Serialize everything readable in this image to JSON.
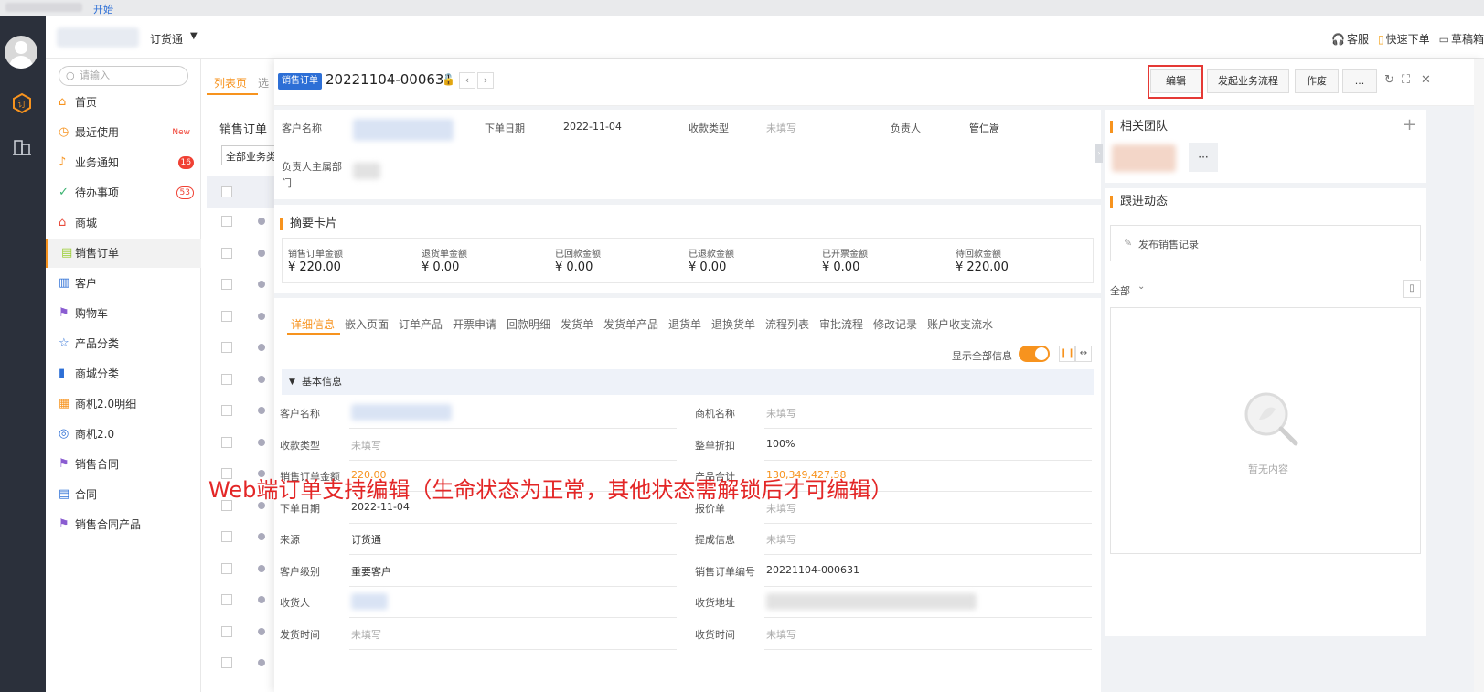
{
  "topstrip": {
    "start": "开始"
  },
  "header": {
    "app_name": "订货通",
    "right": [
      {
        "icon": "headset-icon",
        "glyph": "🎧",
        "label": "客服"
      },
      {
        "icon": "quick-order-icon",
        "glyph": "▯",
        "label": "快速下单"
      },
      {
        "icon": "draft-icon",
        "glyph": "▭",
        "label": "草稿箱"
      }
    ]
  },
  "sidenav": {
    "search_placeholder": "请输入",
    "items": [
      {
        "label": "首页",
        "icon": "home-icon",
        "glyph": "⌂",
        "color": "#f7931e"
      },
      {
        "label": "最近使用",
        "icon": "clock-icon",
        "glyph": "◷",
        "color": "#f7931e",
        "tag": "New"
      },
      {
        "label": "业务通知",
        "icon": "bell-icon",
        "glyph": "♪",
        "color": "#f7931e",
        "badge": "16"
      },
      {
        "label": "待办事项",
        "icon": "check-circle-icon",
        "glyph": "✓",
        "color": "#3cb371",
        "badge_outline": "53"
      },
      {
        "label": "商城",
        "icon": "shop-icon",
        "glyph": "⌂",
        "color": "#e84c3d"
      },
      {
        "label": "销售订单",
        "icon": "order-icon",
        "glyph": "▤",
        "color": "#9acd32",
        "active": true
      },
      {
        "label": "客户",
        "icon": "customer-icon",
        "glyph": "▥",
        "color": "#2d6fd6"
      },
      {
        "label": "购物车",
        "icon": "flag-icon",
        "glyph": "⚑",
        "color": "#8a5cd1"
      },
      {
        "label": "产品分类",
        "icon": "product-category-icon",
        "glyph": "☆",
        "color": "#2d6fd6"
      },
      {
        "label": "商城分类",
        "icon": "bar-chart-icon",
        "glyph": "▮",
        "color": "#2d6fd6"
      },
      {
        "label": "商机2.0明细",
        "icon": "opportunity-detail-icon",
        "glyph": "▦",
        "color": "#f7931e"
      },
      {
        "label": "商机2.0",
        "icon": "target-icon",
        "glyph": "◎",
        "color": "#2d6fd6"
      },
      {
        "label": "销售合同",
        "icon": "flag-icon",
        "glyph": "⚑",
        "color": "#8a5cd1"
      },
      {
        "label": "合同",
        "icon": "contract-icon",
        "glyph": "▤",
        "color": "#2d6fd6"
      },
      {
        "label": "销售合同产品",
        "icon": "flag-icon",
        "glyph": "⚑",
        "color": "#8a5cd1"
      }
    ]
  },
  "listpane": {
    "tab_active": "列表页",
    "tab_other": "选",
    "title": "销售订单",
    "filter": "全部业务类型"
  },
  "drawer": {
    "tag": "销售订单",
    "order_no": "20221104-000631",
    "buttons": {
      "edit": "编辑",
      "start_flow": "发起业务流程",
      "void": "作废",
      "more": "..."
    },
    "info": {
      "customer_name_label": "客户名称",
      "order_date_label": "下单日期",
      "order_date": "2022-11-04",
      "collection_type_label": "收款类型",
      "collection_type": "未填写",
      "owner_label": "负责人",
      "owner": "管仁嵩",
      "owner_dept_label_1": "负责人主属部",
      "owner_dept_label_2": "门"
    },
    "summary": {
      "title": "摘要卡片",
      "items": [
        {
          "label": "销售订单金额",
          "value": "¥ 220.00"
        },
        {
          "label": "退货单金额",
          "value": "¥ 0.00"
        },
        {
          "label": "已回款金额",
          "value": "¥ 0.00"
        },
        {
          "label": "已退款金额",
          "value": "¥ 0.00"
        },
        {
          "label": "已开票金额",
          "value": "¥ 0.00"
        },
        {
          "label": "待回款金额",
          "value": "¥ 220.00"
        }
      ]
    },
    "tabs": [
      "详细信息",
      "嵌入页面",
      "订单产品",
      "开票申请",
      "回款明细",
      "发货单",
      "发货单产品",
      "退货单",
      "退换货单",
      "流程列表",
      "审批流程",
      "修改记录",
      "账户收支流水"
    ],
    "show_all_label": "显示全部信息",
    "basic_info": "基本信息",
    "fields_left": [
      {
        "label": "客户名称",
        "value": "",
        "blur": true
      },
      {
        "label": "收款类型",
        "value": "未填写",
        "muted": true
      },
      {
        "label": "销售订单金额",
        "value": "220.00",
        "orange": true
      },
      {
        "label": "下单日期",
        "value": "2022-11-04"
      },
      {
        "label": "来源",
        "value": "订货通"
      },
      {
        "label": "客户级别",
        "value": "重要客户"
      },
      {
        "label": "收货人",
        "value": "",
        "blur": true
      },
      {
        "label": "发货时间",
        "value": "未填写",
        "muted": true
      }
    ],
    "fields_right": [
      {
        "label": "商机名称",
        "value": "未填写",
        "muted": true
      },
      {
        "label": "整单折扣",
        "value": "100%"
      },
      {
        "label": "产品合计",
        "value": "130,349,427.58",
        "orange": true
      },
      {
        "label": "报价单",
        "value": "未填写",
        "muted": true
      },
      {
        "label": "提成信息",
        "value": "未填写",
        "muted": true
      },
      {
        "label": "销售订单编号",
        "value": "20221104-000631"
      },
      {
        "label": "收货地址",
        "value": "",
        "blur": true
      },
      {
        "label": "收货时间",
        "value": "未填写",
        "muted": true
      }
    ],
    "related_team": "相关团队",
    "team_more": "···",
    "followup": "跟进动态",
    "publish_record": "发布销售记录",
    "filter_all": "全部",
    "empty": "暂无内容"
  },
  "annotation": "Web端订单支持编辑（生命状态为正常，其他状态需解锁后才可编辑）",
  "colors": {
    "accent": "#f7931e",
    "primary": "#2d6fd6",
    "annotation": "#e32626",
    "sidebar": "#2b303b"
  }
}
